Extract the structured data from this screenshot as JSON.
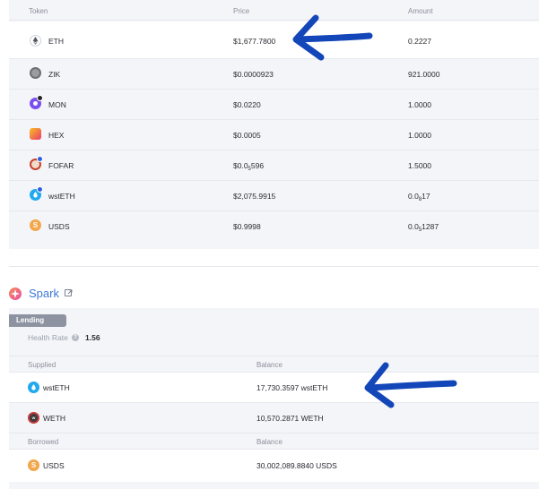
{
  "wallet": {
    "headers": {
      "token": "Token",
      "price": "Price",
      "amount": "Amount"
    },
    "rows": [
      {
        "symbol": "ETH",
        "price": "$1,677.7800",
        "amount": "0.2227",
        "icon": "eth-icon"
      },
      {
        "symbol": "ZIK",
        "price": "$0.0000923",
        "amount": "921.0000",
        "icon": "zik-icon"
      },
      {
        "symbol": "MON",
        "price": "$0.0220",
        "amount": "1.0000",
        "icon": "mon-icon"
      },
      {
        "symbol": "HEX",
        "price": "$0.0005",
        "amount": "1.0000",
        "icon": "hex-icon"
      },
      {
        "symbol": "FOFAR",
        "price_prefix": "$0.0",
        "price_sub": "5",
        "price_suffix": "596",
        "amount": "1.5000",
        "icon": "fofar-icon"
      },
      {
        "symbol": "wstETH",
        "price": "$2,075.9915",
        "amount_prefix": "0.0",
        "amount_sub": "8",
        "amount_suffix": "17",
        "icon": "wsteth-icon"
      },
      {
        "symbol": "USDS",
        "price": "$0.9998",
        "amount_prefix": "0.0",
        "amount_sub": "5",
        "amount_suffix": "1287",
        "icon": "usds-icon"
      }
    ]
  },
  "spark": {
    "title": "Spark",
    "lending_tag": "Lending",
    "health_label": "Health Rate",
    "health_value": "1.56",
    "supplied_header": "Supplied",
    "balance_header": "Balance",
    "supplied": [
      {
        "symbol": "wstETH",
        "balance": "17,730.3597 wstETH"
      },
      {
        "symbol": "WETH",
        "balance": "10,570.2871 WETH"
      }
    ],
    "borrowed_header": "Borrowed",
    "borrowed": [
      {
        "symbol": "USDS",
        "balance": "30,002,089.8840 USDS"
      }
    ]
  },
  "colors": {
    "arrow": "#1346b8",
    "spark_title": "#3d78d8",
    "lending_tag_bg": "#8d93a1"
  }
}
